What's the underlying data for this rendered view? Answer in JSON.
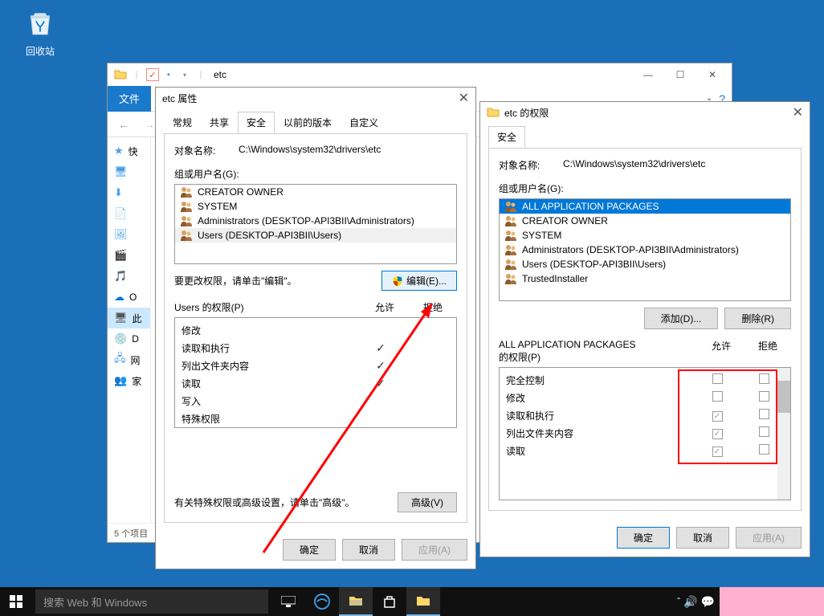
{
  "desktop": {
    "recycle_bin": "回收站"
  },
  "explorer": {
    "title": "etc",
    "file_tab": "文件",
    "sidebar": [
      {
        "icon": "star",
        "label": "快",
        "color": "#4aa0e8"
      },
      {
        "icon": "monitor",
        "label": "",
        "color": "#4aa0e8"
      },
      {
        "icon": "download",
        "label": "",
        "color": "#4aa0e8"
      },
      {
        "icon": "doc",
        "label": "",
        "color": "#4aa0e8"
      },
      {
        "icon": "picture",
        "label": "",
        "color": "#4aa0e8"
      },
      {
        "icon": "video",
        "label": "",
        "color": "#ff8c00"
      },
      {
        "icon": "music",
        "label": "",
        "color": "#4aa0e8"
      },
      {
        "icon": "onedrive",
        "label": "O",
        "color": "#0078d7"
      },
      {
        "icon": "pc",
        "label": "此",
        "color": "#555",
        "selected": true
      },
      {
        "icon": "cd",
        "label": "D",
        "color": "#888"
      },
      {
        "icon": "network",
        "label": "网",
        "color": "#4aa0e8"
      },
      {
        "icon": "homegroup",
        "label": "家",
        "color": "#4aa0e8"
      }
    ],
    "status": "5 个项目"
  },
  "props": {
    "title": "etc 属性",
    "tabs": [
      "常规",
      "共享",
      "安全",
      "以前的版本",
      "自定义"
    ],
    "active_tab": 2,
    "object_label": "对象名称:",
    "object_value": "C:\\Windows\\system32\\drivers\\etc",
    "groups_label": "组或用户名(G):",
    "users": [
      "CREATOR OWNER",
      "SYSTEM",
      "Administrators (DESKTOP-API3BII\\Administrators)",
      "Users (DESKTOP-API3BII\\Users)"
    ],
    "selected_user": 3,
    "edit_text": "要更改权限，请单击\"编辑\"。",
    "edit_btn": "编辑(E)...",
    "perms_for": "Users 的权限(P)",
    "col_allow": "允许",
    "col_deny": "拒绝",
    "perms": [
      {
        "name": "修改",
        "allow": false,
        "deny": false
      },
      {
        "name": "读取和执行",
        "allow": true,
        "deny": false
      },
      {
        "name": "列出文件夹内容",
        "allow": true,
        "deny": false
      },
      {
        "name": "读取",
        "allow": true,
        "deny": false
      },
      {
        "name": "写入",
        "allow": false,
        "deny": false
      },
      {
        "name": "特殊权限",
        "allow": false,
        "deny": false
      }
    ],
    "advanced_text": "有关特殊权限或高级设置，请单击\"高级\"。",
    "advanced_btn": "高级(V)",
    "ok": "确定",
    "cancel": "取消",
    "apply": "应用(A)"
  },
  "perms_dlg": {
    "title": "etc 的权限",
    "tab": "安全",
    "object_label": "对象名称:",
    "object_value": "C:\\Windows\\system32\\drivers\\etc",
    "groups_label": "组或用户名(G):",
    "users": [
      "ALL APPLICATION PACKAGES",
      "CREATOR OWNER",
      "SYSTEM",
      "Administrators (DESKTOP-API3BII\\Administrators)",
      "Users (DESKTOP-API3BII\\Users)",
      "TrustedInstaller"
    ],
    "selected_user": 0,
    "add_btn": "添加(D)...",
    "remove_btn": "删除(R)",
    "perms_for1": "ALL APPLICATION PACKAGES",
    "perms_for2": "的权限(P)",
    "col_allow": "允许",
    "col_deny": "拒绝",
    "perms": [
      {
        "name": "完全控制",
        "allow": false,
        "deny": false
      },
      {
        "name": "修改",
        "allow": false,
        "deny": false
      },
      {
        "name": "读取和执行",
        "allow": true,
        "deny": false
      },
      {
        "name": "列出文件夹内容",
        "allow": true,
        "deny": false
      },
      {
        "name": "读取",
        "allow": true,
        "deny": false
      }
    ],
    "ok": "确定",
    "cancel": "取消",
    "apply": "应用(A)"
  },
  "taskbar": {
    "search_placeholder": "搜索 Web 和 Windows"
  }
}
